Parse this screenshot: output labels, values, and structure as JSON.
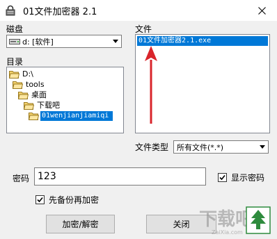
{
  "window": {
    "title": "01文件加密器 2.1"
  },
  "drive": {
    "label": "磁盘",
    "value": "d: [软件]"
  },
  "directory": {
    "label": "目录",
    "items": [
      {
        "label": "D:\\"
      },
      {
        "label": "tools"
      },
      {
        "label": "桌面"
      },
      {
        "label": "下载吧"
      },
      {
        "label": "01wenjianjiamiqi"
      }
    ]
  },
  "files": {
    "label": "文件",
    "items": [
      "01文件加密器2.1.exe"
    ]
  },
  "filetype": {
    "label": "文件类型",
    "value": "所有文件(*.*)"
  },
  "password": {
    "label": "密码",
    "value": "123",
    "show_label": "显示密码",
    "show_checked": true
  },
  "backup": {
    "label": "先备份再加密",
    "checked": true
  },
  "buttons": {
    "encrypt": "加密/解密",
    "close": "关闭"
  },
  "watermark": {
    "text": "下载吧",
    "sub": "ZaiXia.com"
  },
  "colors": {
    "selection": "#0078d7",
    "annotation_arrow": "#d9242b",
    "watermark_green": "#2e8b3d"
  }
}
